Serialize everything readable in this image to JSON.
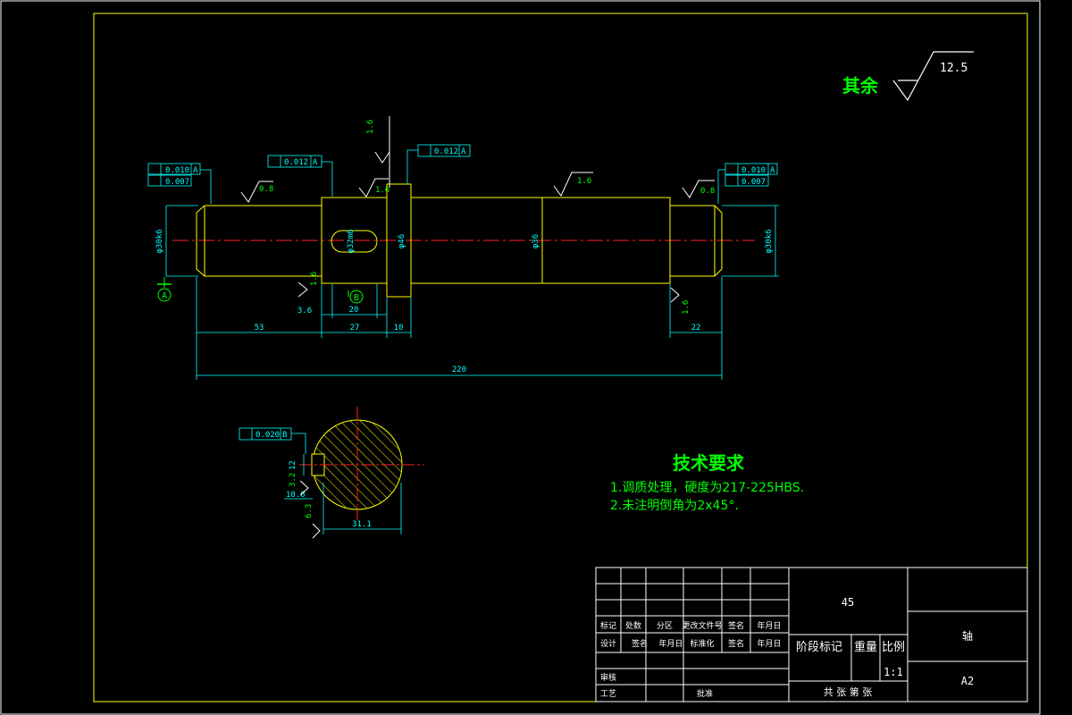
{
  "roughness_note": {
    "label": "其余",
    "value": "12.5"
  },
  "tech_requirements": {
    "title": "技术要求",
    "items": [
      "1.调质处理，硬度为217-225HBS.",
      "2.未注明倒角为2x45°."
    ]
  },
  "dimensions": {
    "len_53": "53",
    "len_27": "27",
    "len_10": "10",
    "len_22": "22",
    "len_220": "220",
    "len_3_6": "3.6",
    "len_20": "20",
    "key_depth": "10.8",
    "sec_31": "31.1",
    "dia_left": "φ30k6",
    "dia_key": "φ32m6",
    "dia_collar": "φ46",
    "dia_mid": "φ36",
    "dia_right": "φ30k6",
    "sec_12": "12"
  },
  "roughness_values": {
    "r_08_left": "0.8",
    "r_16_top": "1.6",
    "r_16_shoulder": "1.6",
    "r_16_mid": "1.6",
    "r_08_right": "0.8",
    "r_16_bottom_left": "1.6",
    "r_16_bottom_right": "1.6",
    "r_63": "6.3",
    "r_32": "3.2"
  },
  "tolerances": {
    "left_runout": "0.010",
    "left_runout_ref": "A",
    "left_cyl": "0.007",
    "key_sym": "0.012",
    "key_sym_ref": "A",
    "collar_runout": "0.012",
    "collar_runout_ref": "A",
    "right_runout": "0.010",
    "right_runout_ref": "A",
    "right_cyl": "0.007",
    "section_sym": "0.020",
    "section_sym_ref": "B"
  },
  "datums": {
    "a": "A",
    "b": "B"
  },
  "title_block": {
    "material": "45",
    "part_name": "轴",
    "drawing_no": "A2",
    "scale": "1:1",
    "row_labels": [
      "标记",
      "处数",
      "分区",
      "更改文件号",
      "签名",
      "年月日"
    ],
    "row_labels2": [
      "设计",
      "签名",
      "年月日",
      "标准化",
      "签名",
      "年月日"
    ],
    "review": "审核",
    "process": "工艺",
    "approve": "批准",
    "stage_mark": "阶段标记",
    "weight": "重量",
    "ratio": "比例",
    "sheets": "共  张  第  张"
  },
  "colors": {
    "frame": "#ffff00",
    "shaft": "#ffff00",
    "dim": "#00ffff",
    "center": "#ff2020",
    "text_green": "#00ff00",
    "hatch": "#ffff00",
    "white": "#ffffff"
  }
}
